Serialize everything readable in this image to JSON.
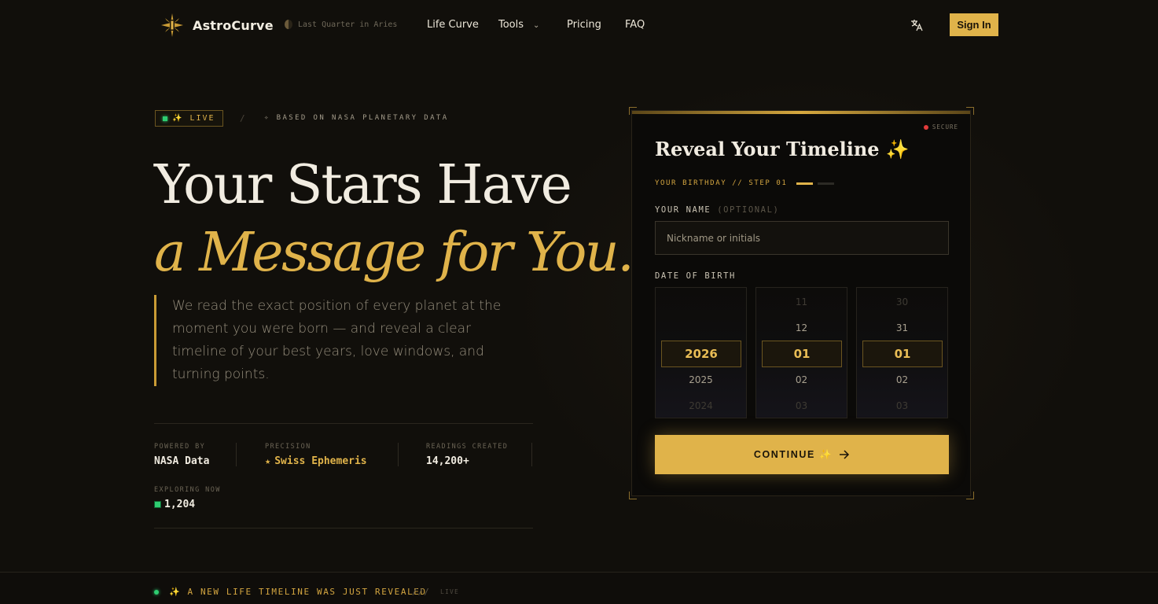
{
  "nav": {
    "brand": "AstroCurve",
    "moon_phase": "Last Quarter in Aries",
    "links": [
      "Life Curve",
      "Tools",
      "Pricing",
      "FAQ"
    ],
    "signin_label": "Sign In"
  },
  "hero": {
    "live_label": "✨ LIVE",
    "source_tag": "✧ BASED ON NASA PLANETARY DATA",
    "headline_line1": "Your Stars Have",
    "headline_line2": "a Message for You.",
    "description": "We read the exact position of every planet at the moment you were born — and reveal a clear timeline of your best years, love windows, and turning points."
  },
  "stats": [
    {
      "label": "POWERED BY",
      "value": "NASA Data"
    },
    {
      "label": "PRECISION",
      "value": "Swiss Ephemeris"
    },
    {
      "label": "READINGS CREATED",
      "value": "14,200+"
    },
    {
      "label": "EXPLORING NOW",
      "value": "1,204"
    }
  ],
  "card": {
    "secure_label": "SECURE",
    "title": "Reveal Your Timeline ✨",
    "step_label": "YOUR BIRTHDAY // STEP 01",
    "name_label": "YOUR NAME",
    "name_optional": "(OPTIONAL)",
    "name_placeholder": "Nickname or initials",
    "dob_label": "DATE OF BIRTH",
    "year_wheel": {
      "above2": "",
      "above1": "",
      "selected": "2026",
      "below1": "2025",
      "below2": "2024"
    },
    "month_wheel": {
      "above2": "11",
      "above1": "12",
      "selected": "01",
      "below1": "02",
      "below2": "03"
    },
    "day_wheel": {
      "above2": "30",
      "above1": "31",
      "selected": "01",
      "below1": "02",
      "below2": "03"
    },
    "continue_label": "CONTINUE ✨"
  },
  "ticker": {
    "message": "✨ A NEW LIFE TIMELINE WAS JUST REVEALED",
    "separator": "///",
    "live": "LIVE"
  },
  "colors": {
    "accent": "#e0b34a",
    "background": "#110f0b",
    "live_green": "#2ecc71",
    "secure_red": "#e23b3b"
  },
  "icons": [
    "logo-star-icon",
    "moon-icon",
    "chevron-down-icon",
    "translate-icon",
    "star-icon",
    "arrow-right-icon"
  ]
}
